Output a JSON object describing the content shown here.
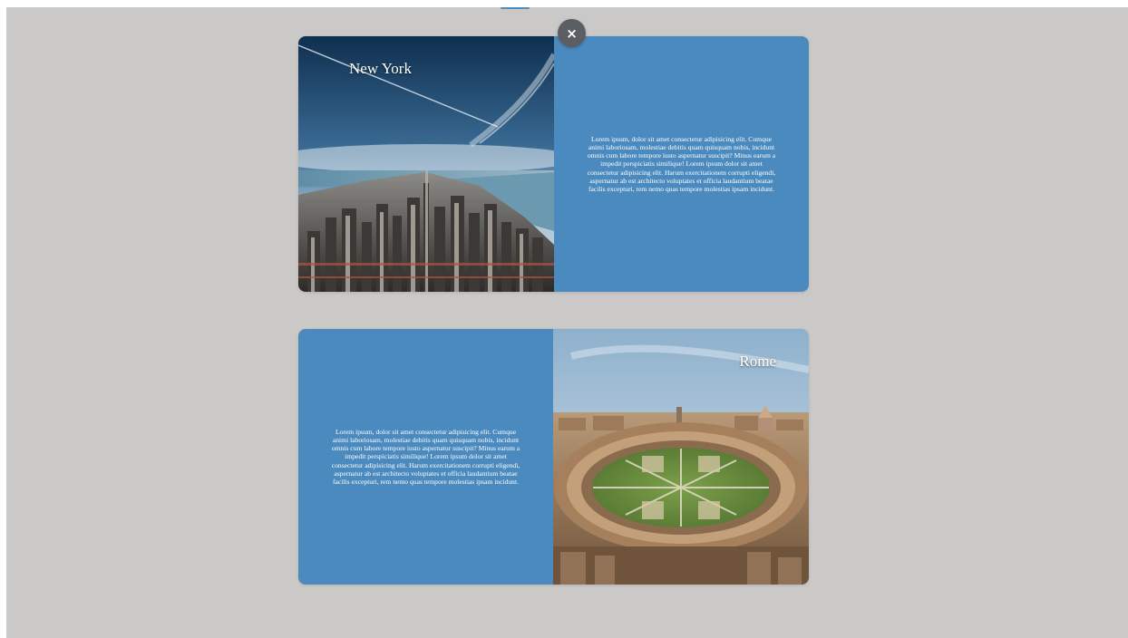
{
  "close_button": {
    "label": "×",
    "icon": "close-icon"
  },
  "cards": [
    {
      "city": "New York",
      "description": "Lorem ipsum, dolor sit amet consectetur adipisicing elit. Cumque animi laboriosam, molestiae debitis quam quisquam nobis, incidunt omnis cum labore tempore iusto aspernatur suscipit? Minus earum a impedit perspiciatis similique! Lorem ipsum dolor sit amet consectetur adipisicing elit. Harum exercitationem corrupti eligendi, aspernatur ab est architecto voluptates et officia laudantium beatae facilis excepturi, rem nemo quas tempore molestias ipsam incidunt."
    },
    {
      "city": "Rome",
      "description": "Lorem ipsum, dolor sit amet consectetur adipisicing elit. Cumque animi laboriosam, molestiae debitis quam quisquam nobis, incidunt omnis cum labore tempore iusto aspernatur suscipit? Minus earum a impedit perspiciatis similique! Lorem ipsum dolor sit amet consectetur adipisicing elit. Harum exercitationem corrupti eligendi, aspernatur ab est architecto voluptates et officia laudantium beatae facilis excepturi, rem nemo quas tempore molestias ipsam incidunt."
    }
  ],
  "colors": {
    "page_background": "#cbc9c7",
    "panel": "#4b8abe",
    "close_button": "#5b5e62",
    "text": "#ffffff"
  }
}
